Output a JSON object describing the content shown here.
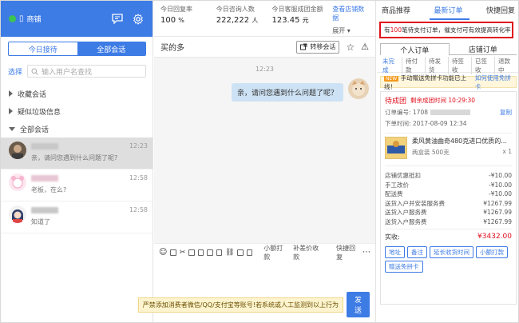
{
  "sidebar": {
    "shop_name": "商铺",
    "tabs": [
      "今日接待",
      "全部会话"
    ],
    "select_label": "选择",
    "search_placeholder": "输入用户名查找",
    "groups": [
      "收藏会话",
      "疑似垃圾信息",
      "全部会话"
    ],
    "conversations": [
      {
        "message": "亲，请问您遇到什么问题了呢?",
        "time": "12:23"
      },
      {
        "message": "老板，在么?",
        "time": "12:58"
      },
      {
        "message": "知道了",
        "time": "12:58"
      }
    ]
  },
  "stats": {
    "items": [
      {
        "label": "今日回复率",
        "value": "100",
        "unit": "%"
      },
      {
        "label": "今日咨询人数",
        "value": "222,222",
        "unit": "人"
      },
      {
        "label": "今日客服成团金额",
        "value": "123.45",
        "unit": "元"
      }
    ],
    "link": "查看店铺数据",
    "expand": "展开"
  },
  "chat": {
    "customer_name": "买的多",
    "transfer_button": "转移会话",
    "timestamp": "12:23",
    "bubble": "亲，请问您遇到什么问题了呢？",
    "toolbar_text": [
      "小额打款",
      "补差价收款",
      "快捷回复"
    ],
    "warning": "严禁添加消费者微信/QQ/支付宝等账号!若系统或人工监测到以上行为",
    "send": "发送"
  },
  "right": {
    "tabs": [
      "商品推荐",
      "最新订单",
      "快捷回复"
    ],
    "notice_prefix": "有",
    "notice_count": "100",
    "notice_suffix": "笔待支付订单，催支付可有效提高转化率",
    "order_tabs": [
      "个人订单",
      "店铺订单"
    ],
    "filters": [
      "未完成",
      "待付款",
      "待发货",
      "待签收",
      "已签收",
      "退款中"
    ],
    "promo_badge": "NEW",
    "promo_text": "手动赠送免拼卡功能已上线！",
    "promo_link": "如何使用免拼卡",
    "order": {
      "status": "待成团",
      "remaining": "剩余成团时间 10:29:30",
      "order_no_label": "订单编号: 1708",
      "copy": "复制",
      "order_time": "下单时间: 2017-08-09 12:34",
      "product_name": "柔风黄油曲奇480克进口优质的...",
      "product_spec": "两盒装 500克",
      "product_qty": "x 1",
      "lines": [
        {
          "label": "店铺优惠抵扣",
          "value": "-¥10.00"
        },
        {
          "label": "手工改价",
          "value": "-¥10.00"
        },
        {
          "label": "配送费",
          "value": "-¥10.00"
        },
        {
          "label": "送货入户并安装服务费",
          "value": "¥1267.99"
        },
        {
          "label": "送货入户服务费",
          "value": "¥1267.99"
        },
        {
          "label": "送货入户服务费",
          "value": "¥1267.99"
        }
      ],
      "paid_label": "实收:",
      "paid_value": "¥3432.00",
      "actions": [
        "地址",
        "备注",
        "延长收货时间",
        "小额打款",
        "赠送免拼卡"
      ]
    }
  }
}
